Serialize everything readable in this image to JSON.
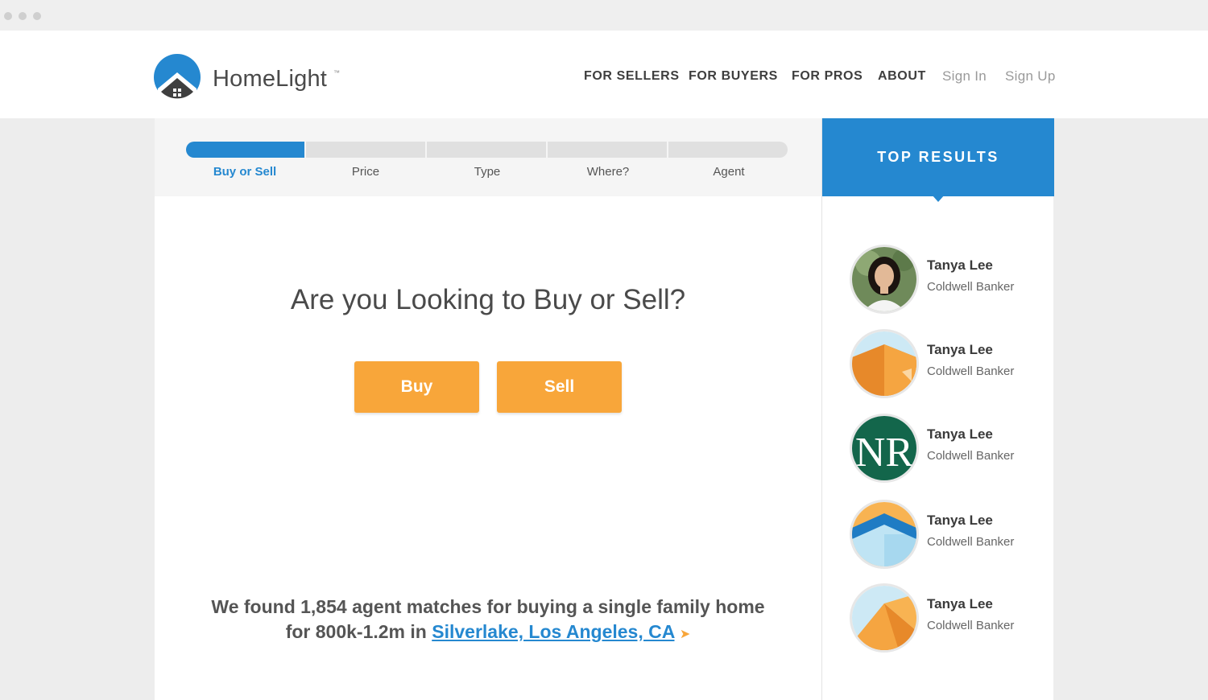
{
  "header": {
    "brand": "HomeLight",
    "trademark": "™",
    "nav": [
      {
        "label": "FOR SELLERS"
      },
      {
        "label": "FOR BUYERS"
      },
      {
        "label": "FOR PROS"
      },
      {
        "label": "ABOUT"
      },
      {
        "label": "Sign In"
      },
      {
        "label": "Sign Up"
      }
    ]
  },
  "progress": {
    "steps": [
      {
        "label": "Buy or Sell",
        "active": true
      },
      {
        "label": "Price",
        "active": false
      },
      {
        "label": "Type",
        "active": false
      },
      {
        "label": "Where?",
        "active": false
      },
      {
        "label": "Agent",
        "active": false
      }
    ]
  },
  "main": {
    "question": "Are you Looking to Buy or Sell?",
    "buy_label": "Buy",
    "sell_label": "Sell",
    "matches_line1": "We found 1,854 agent matches for buying a single family home",
    "matches_line2_prefix": "for 800k-1.2m in ",
    "location": "Silverlake, Los Angeles, CA"
  },
  "sidebar": {
    "title": "TOP RESULTS",
    "agents": [
      {
        "name": "Tanya Lee",
        "company": "Coldwell Banker",
        "avatar": "person-photo"
      },
      {
        "name": "Tanya Lee",
        "company": "Coldwell Banker",
        "avatar": "orange-house-logo"
      },
      {
        "name": "Tanya Lee",
        "company": "Coldwell Banker",
        "avatar": "nr-monogram-logo"
      },
      {
        "name": "Tanya Lee",
        "company": "Coldwell Banker",
        "avatar": "blue-roof-logo"
      },
      {
        "name": "Tanya Lee",
        "company": "Coldwell Banker",
        "avatar": "orange-pyramid-logo"
      }
    ]
  },
  "colors": {
    "brand_blue": "#2588d0",
    "cta_orange": "#f8a63a",
    "text_dark": "#4a4a4a"
  }
}
